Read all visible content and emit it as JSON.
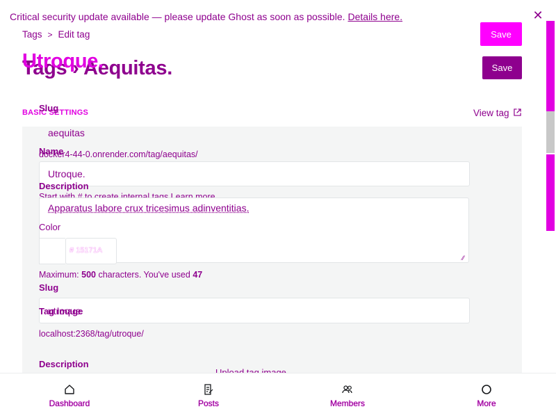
{
  "banner": {
    "message": "Critical security update available — please update Ghost as soon as possible.",
    "link": "Details here.",
    "close": "✕"
  },
  "breadcrumbs": {
    "parent": "Tags",
    "separator": ">",
    "current": "Edit tag"
  },
  "header": {
    "title_main": "Tags › Aequitas.",
    "title_over": "Utroque.",
    "save_primary": "Save",
    "save_secondary": "Save"
  },
  "settings": {
    "section_label": "BASIC SETTINGS",
    "view_tag": "View tag",
    "slug_label_top": "Slug",
    "slug_value_top": "aequitas",
    "url_top": "docker4-44-0.onrender.com/tag/aequitas/",
    "name_label": "Name",
    "name_value": "Utroque.",
    "description_label_top": "Description",
    "name_hint": "Start with # to create internal tags Learn more",
    "description_value": "Apparatus labore crux tricesimus adinventitias.",
    "color_label": "Color",
    "color_value": "15171A",
    "char_count_prefix": "Maximum:",
    "char_count_max": "500",
    "char_count_mid": "characters. You've used",
    "char_count_used": "47",
    "slug_label": "Slug",
    "slug_value": "utroque",
    "tag_image_label": "Tag image",
    "url": "localhost:2368/tag/utroque/",
    "description_label": "Description",
    "upload_label": "Upload tag image"
  },
  "nav": {
    "items": [
      {
        "label": "Dashboard",
        "icon": "home-icon"
      },
      {
        "label": "Posts",
        "icon": "posts-icon"
      },
      {
        "label": "Members",
        "icon": "members-icon"
      },
      {
        "label": "More",
        "icon": "more-icon"
      }
    ]
  },
  "colors": {
    "accent": "#e100e1",
    "accent_dark": "#8e008e",
    "button": "#ff00ff"
  }
}
